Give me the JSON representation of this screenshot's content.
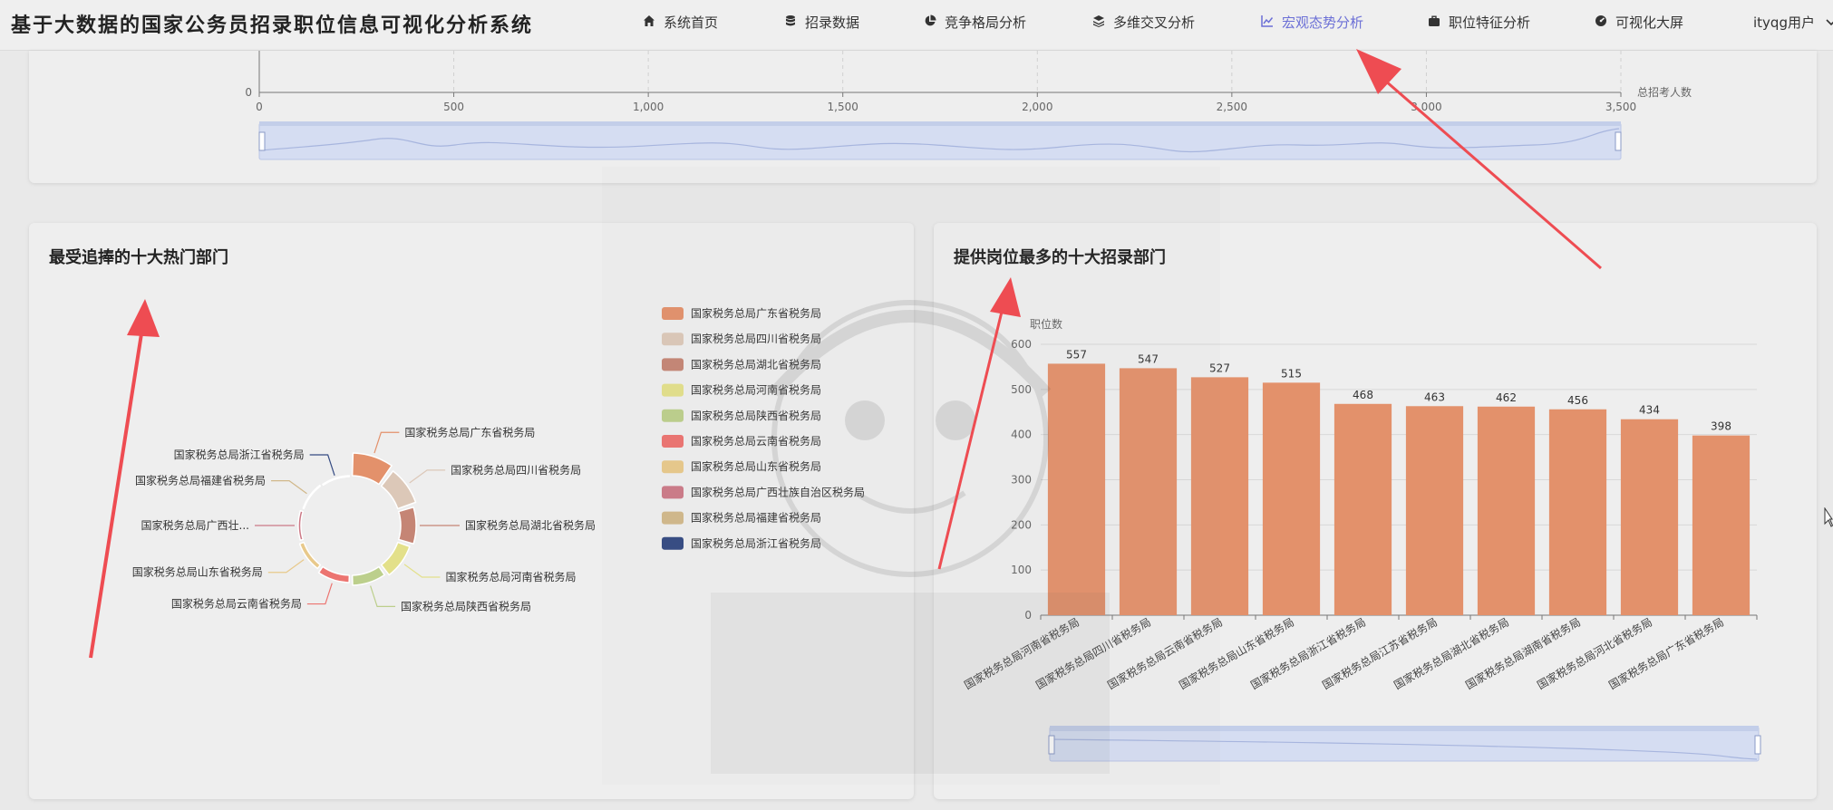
{
  "app": {
    "title": "基于大数据的国家公务员招录职位信息可视化分析系统"
  },
  "nav": {
    "items": [
      {
        "label": "系统首页",
        "icon": "home-icon"
      },
      {
        "label": "招录数据",
        "icon": "database-icon"
      },
      {
        "label": "竞争格局分析",
        "icon": "pie-chart-icon"
      },
      {
        "label": "多维交叉分析",
        "icon": "layers-icon"
      },
      {
        "label": "宏观态势分析",
        "icon": "line-chart-icon",
        "active": true
      },
      {
        "label": "职位特征分析",
        "icon": "briefcase-icon"
      },
      {
        "label": "可视化大屏",
        "icon": "dashboard-icon"
      }
    ],
    "user": "ityqg用户",
    "active_color": "#6b6fd6"
  },
  "top_chart": {
    "x_ticks": [
      "0",
      "500",
      "1,000",
      "1,500",
      "2,000",
      "2,500",
      "3,000",
      "3,500"
    ],
    "y_tick": "0",
    "x_axis_label": "总招考人数"
  },
  "left_panel": {
    "title": "最受追捧的十大热门部门"
  },
  "right_panel": {
    "title": "提供岗位最多的十大招录部门"
  },
  "chart_data": [
    {
      "type": "pie",
      "subtype": "rose-donut",
      "title": "最受追捧的十大热门部门",
      "legend_position": "right",
      "slices": [
        {
          "label": "国家税务总局广东省税务局",
          "color": "#e3916b"
        },
        {
          "label": "国家税务总局四川省税务局",
          "color": "#dcc8b8"
        },
        {
          "label": "国家税务总局湖北省税务局",
          "color": "#c58575"
        },
        {
          "label": "国家税务总局河南省税务局",
          "color": "#e3e08a"
        },
        {
          "label": "国家税务总局陕西省税务局",
          "color": "#bccf8c"
        },
        {
          "label": "国家税务总局云南省税务局",
          "color": "#ec7470"
        },
        {
          "label": "国家税务总局山东省税务局",
          "color": "#e8c98b"
        },
        {
          "label": "国家税务总局广西壮族自治区税务局",
          "label_short": "国家税务总局广西壮...",
          "color": "#cc7a87"
        },
        {
          "label": "国家税务总局福建省税务局",
          "color": "#d1b88a"
        },
        {
          "label": "国家税务总局浙江省税务局",
          "color": "#344a82"
        }
      ]
    },
    {
      "type": "bar",
      "title": "提供岗位最多的十大招录部门",
      "ylabel": "职位数",
      "ylim": [
        0,
        600
      ],
      "y_ticks": [
        0,
        100,
        200,
        300,
        400,
        500,
        600
      ],
      "grid": true,
      "bar_color": "#e3916b",
      "categories": [
        "国家税务总局河南省税务局",
        "国家税务总局四川省税务局",
        "国家税务总局云南省税务局",
        "国家税务总局山东省税务局",
        "国家税务总局浙江省税务局",
        "国家税务总局江苏省税务局",
        "国家税务总局湖北省税务局",
        "国家税务总局湖南省税务局",
        "国家税务总局河北省税务局",
        "国家税务总局广东省税务局"
      ],
      "values": [
        557,
        547,
        527,
        515,
        468,
        463,
        462,
        456,
        434,
        398
      ]
    }
  ]
}
